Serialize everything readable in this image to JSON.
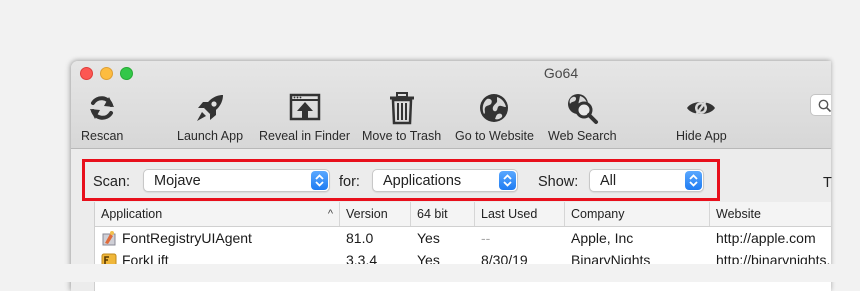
{
  "window": {
    "title": "Go64"
  },
  "toolbar": {
    "rescan": "Rescan",
    "launch_app": "Launch App",
    "reveal_in_finder": "Reveal in Finder",
    "move_to_trash": "Move to Trash",
    "go_to_website": "Go to Website",
    "web_search": "Web Search",
    "hide_app": "Hide App"
  },
  "scan_bar": {
    "scan_label": "Scan:",
    "scan_value": "Mojave",
    "for_label": "for:",
    "for_value": "Applications",
    "show_label": "Show:",
    "show_value": "All",
    "truncated_label": "T"
  },
  "table": {
    "columns": [
      "Application",
      "Version",
      "64 bit",
      "Last Used",
      "Company",
      "Website"
    ],
    "sort_indicator": "^",
    "rows": [
      {
        "application": "FontRegistryUIAgent",
        "version": "81.0",
        "bit64": "Yes",
        "last_used": "--",
        "company": "Apple, Inc",
        "website": "http://apple.com"
      },
      {
        "application": "ForkLift",
        "version": "3.3.4",
        "bit64": "Yes",
        "last_used": "8/30/19",
        "company": "BinaryNights",
        "website": "http://binarynights.com"
      }
    ]
  },
  "colors": {
    "highlight": "#e8101c",
    "select_accent": "#1f7cf2"
  }
}
